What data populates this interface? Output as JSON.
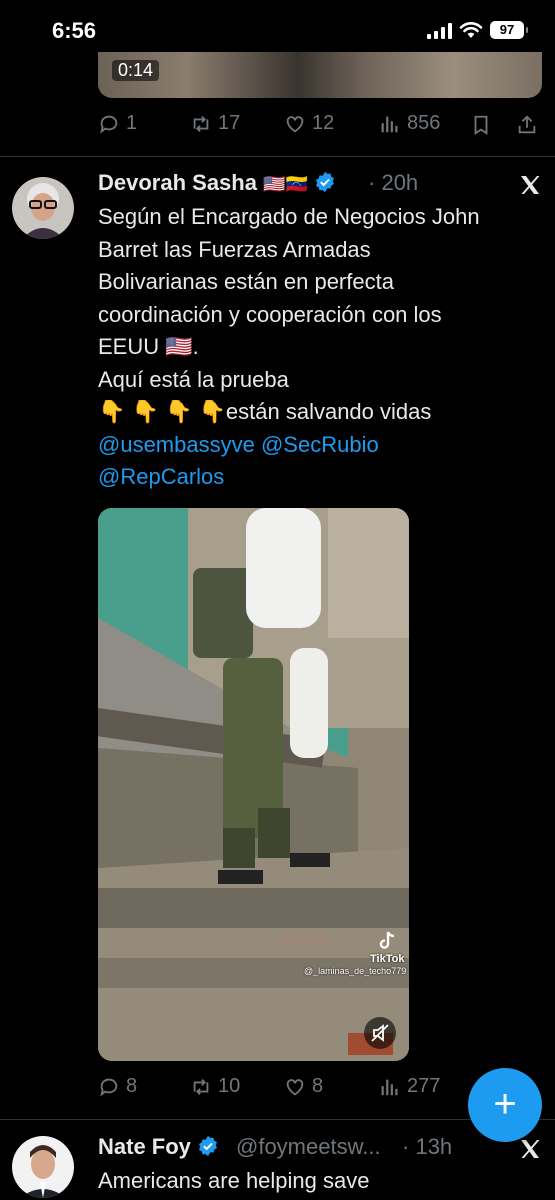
{
  "status_bar": {
    "time": "6:56",
    "battery": "97"
  },
  "top_tweet": {
    "video_duration": "0:14",
    "replies": "1",
    "reposts": "17",
    "likes": "12",
    "views": "856"
  },
  "tweet1": {
    "author": "Devorah Sasha",
    "author_flags": "🇺🇸🇻🇪",
    "time": "20h",
    "lines": [
      "Según el Encargado de Negocios John",
      "Barret las Fuerzas Armadas",
      "Bolivarianas están en perfecta",
      "coordinación y cooperación con los",
      "EEUU 🇺🇸.",
      "Aquí está la prueba",
      "👇 👇 👇 👇están salvando vidas"
    ],
    "mention1": "@usembassyve",
    "mention2": "@SecRubio",
    "mention3": "@RepCarlos",
    "video_watermark_brand": "TikTok",
    "video_watermark_user": "@_laminas_de_techo779",
    "replies": "8",
    "reposts": "10",
    "likes": "8",
    "views": "277"
  },
  "tweet2": {
    "author": "Nate Foy",
    "handle": "@foymeetsw...",
    "time": "13h",
    "first_line": "Americans are helping save"
  },
  "compose_fab": "+",
  "colors": {
    "accent": "#1d9bf0",
    "muted": "#71767b",
    "background": "#000000"
  }
}
